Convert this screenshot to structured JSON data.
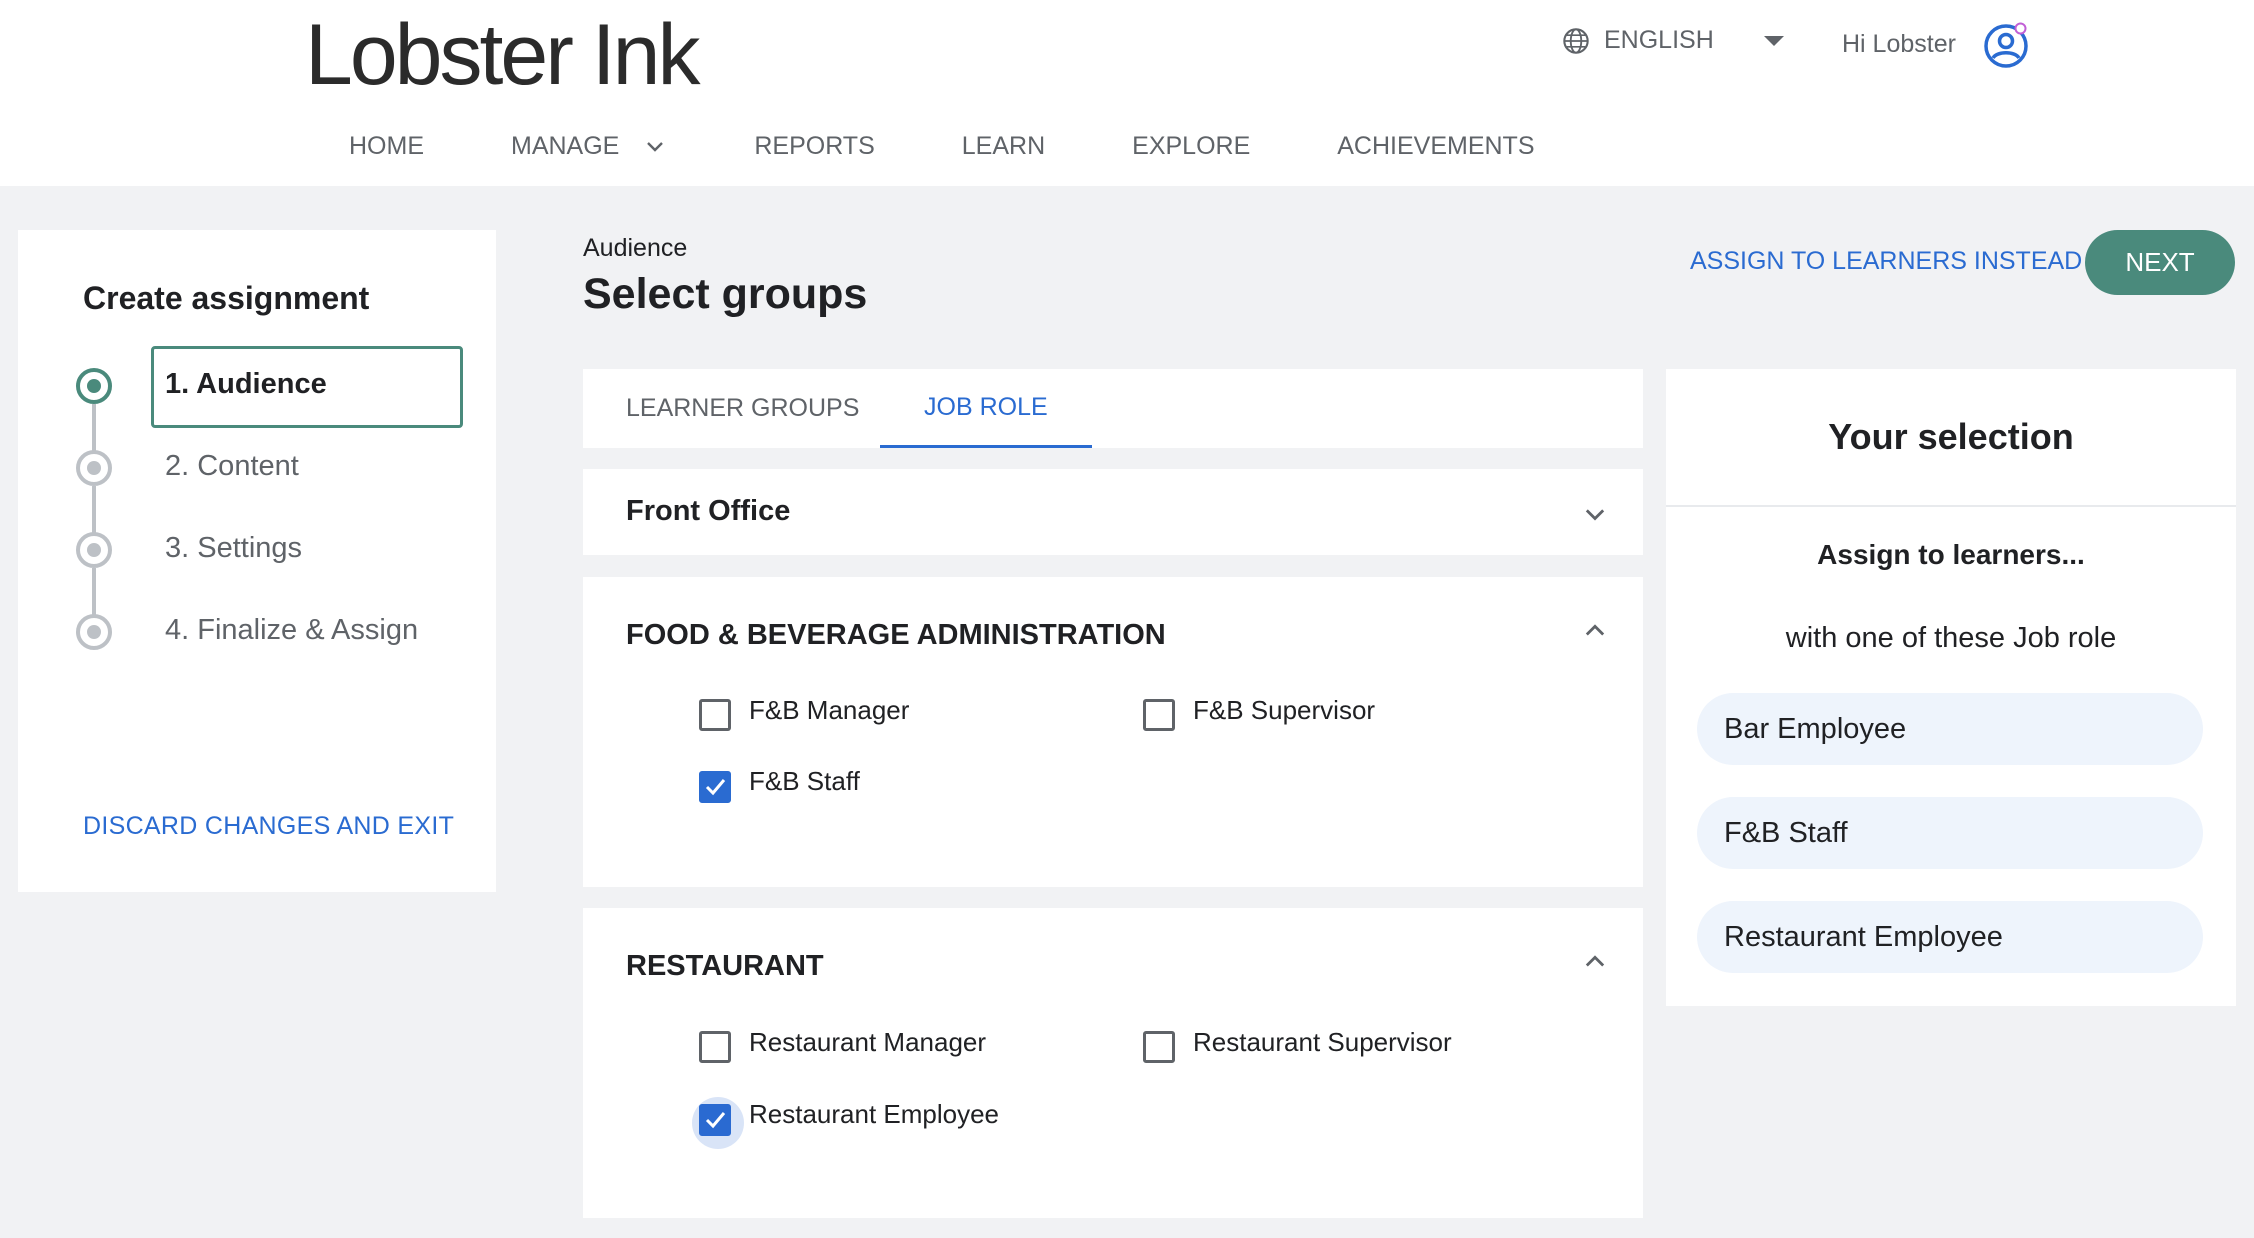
{
  "brand": {
    "logo_text": "Lobster Ink"
  },
  "header": {
    "language": "ENGLISH",
    "greeting": "Hi Lobster",
    "nav": [
      {
        "label": "HOME"
      },
      {
        "label": "MANAGE"
      },
      {
        "label": "REPORTS"
      },
      {
        "label": "LEARN"
      },
      {
        "label": "EXPLORE"
      },
      {
        "label": "ACHIEVEMENTS"
      }
    ]
  },
  "wizard": {
    "title": "Create assignment",
    "steps": [
      {
        "label": "1. Audience",
        "active": true
      },
      {
        "label": "2. Content",
        "active": false
      },
      {
        "label": "3. Settings",
        "active": false
      },
      {
        "label": "4. Finalize & Assign",
        "active": false
      }
    ],
    "discard_label": "DISCARD CHANGES AND EXIT"
  },
  "page": {
    "breadcrumb": "Audience",
    "title": "Select groups",
    "assign_instead_label": "ASSIGN TO LEARNERS INSTEAD",
    "next_label": "NEXT"
  },
  "tabs": [
    {
      "label": "LEARNER GROUPS",
      "active": false
    },
    {
      "label": "JOB ROLE",
      "active": true
    }
  ],
  "panels": [
    {
      "title": "Front Office",
      "expanded": false,
      "options": []
    },
    {
      "title": "FOOD & BEVERAGE ADMINISTRATION",
      "expanded": true,
      "options": [
        {
          "label": "F&B Manager",
          "checked": false
        },
        {
          "label": "F&B Supervisor",
          "checked": false
        },
        {
          "label": "F&B Staff",
          "checked": true
        }
      ]
    },
    {
      "title": "RESTAURANT",
      "expanded": true,
      "options": [
        {
          "label": "Restaurant Manager",
          "checked": false
        },
        {
          "label": "Restaurant Supervisor",
          "checked": false
        },
        {
          "label": "Restaurant Employee",
          "checked": true
        }
      ]
    }
  ],
  "selection": {
    "title": "Your selection",
    "subtitle": "Assign to learners...",
    "description": "with one of these Job role",
    "chips": [
      "Bar Employee",
      "F&B Staff",
      "Restaurant Employee"
    ]
  },
  "colors": {
    "accent_green": "#4a8a7c",
    "link_blue": "#2a6bd1",
    "chip_bg": "#eef4fc",
    "page_bg": "#f1f2f4"
  },
  "icons": {
    "language": "globe-icon",
    "user": "user-avatar-icon",
    "nav_dropdown": "chevron-down-icon",
    "collapse": "chevron-up-icon",
    "check": "check-icon"
  }
}
